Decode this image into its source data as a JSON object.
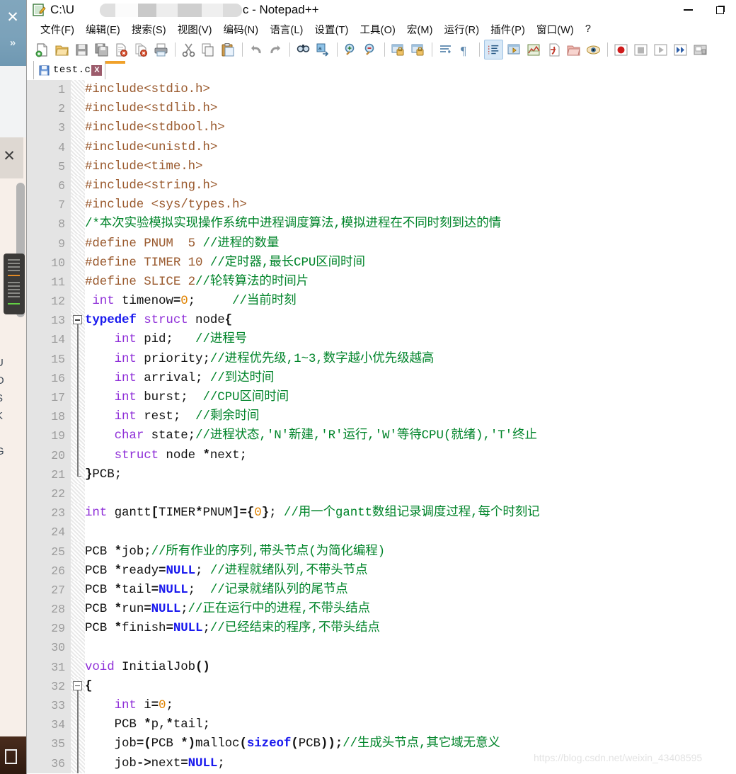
{
  "window": {
    "title_prefix": "C:\\U",
    "title_suffix": "\\test.c - Notepad++",
    "app_icon": "notepad-plus-plus-icon",
    "controls": {
      "minimize": "Minimize",
      "maximize": "Restore",
      "close": "Close"
    }
  },
  "menu": {
    "items": [
      {
        "label": "文件(F)",
        "name": "menu-file"
      },
      {
        "label": "编辑(E)",
        "name": "menu-edit"
      },
      {
        "label": "搜索(S)",
        "name": "menu-search"
      },
      {
        "label": "视图(V)",
        "name": "menu-view"
      },
      {
        "label": "编码(N)",
        "name": "menu-encoding"
      },
      {
        "label": "语言(L)",
        "name": "menu-language"
      },
      {
        "label": "设置(T)",
        "name": "menu-settings"
      },
      {
        "label": "工具(O)",
        "name": "menu-tools"
      },
      {
        "label": "宏(M)",
        "name": "menu-macro"
      },
      {
        "label": "运行(R)",
        "name": "menu-run"
      },
      {
        "label": "插件(P)",
        "name": "menu-plugins"
      },
      {
        "label": "窗口(W)",
        "name": "menu-window"
      },
      {
        "label": "?",
        "name": "menu-help"
      }
    ]
  },
  "toolbar": {
    "buttons": [
      {
        "icon": "new-file-icon",
        "group": 1
      },
      {
        "icon": "open-file-icon",
        "group": 1
      },
      {
        "icon": "save-icon",
        "group": 1
      },
      {
        "icon": "save-all-icon",
        "group": 1
      },
      {
        "icon": "close-file-icon",
        "group": 1
      },
      {
        "icon": "close-all-icon",
        "group": 1
      },
      {
        "icon": "print-icon",
        "group": 1
      },
      {
        "icon": "cut-icon",
        "group": 2
      },
      {
        "icon": "copy-icon",
        "group": 2
      },
      {
        "icon": "paste-icon",
        "group": 2
      },
      {
        "icon": "undo-icon",
        "group": 3
      },
      {
        "icon": "redo-icon",
        "group": 3
      },
      {
        "icon": "find-icon",
        "group": 4
      },
      {
        "icon": "replace-icon",
        "group": 4
      },
      {
        "icon": "zoom-in-icon",
        "group": 5
      },
      {
        "icon": "zoom-out-icon",
        "group": 5
      },
      {
        "icon": "sync-vertical-scroll-icon",
        "group": 6
      },
      {
        "icon": "sync-horizontal-scroll-icon",
        "group": 6
      },
      {
        "icon": "word-wrap-icon",
        "group": 7
      },
      {
        "icon": "show-all-characters-icon",
        "group": 7
      },
      {
        "icon": "indent-guide-icon",
        "group": 8,
        "active": true
      },
      {
        "icon": "user-defined-language-icon",
        "group": 8
      },
      {
        "icon": "document-map-icon",
        "group": 8
      },
      {
        "icon": "function-list-icon",
        "group": 8
      },
      {
        "icon": "folder-as-workspace-icon",
        "group": 8
      },
      {
        "icon": "monitoring-icon",
        "group": 8
      },
      {
        "icon": "macro-record-icon",
        "group": 9
      },
      {
        "icon": "macro-stop-icon",
        "group": 9
      },
      {
        "icon": "macro-play-icon",
        "group": 9
      },
      {
        "icon": "macro-run-multiple-icon",
        "group": 9
      },
      {
        "icon": "macro-save-icon",
        "group": 9
      }
    ]
  },
  "tab": {
    "label": "test.c",
    "icon": "saved-file-icon",
    "close_label": "X"
  },
  "watermark": "https://blog.csdn.net/weixin_43408595",
  "colors": {
    "preprocessor": "#9a5a2e",
    "comment": "#00842a",
    "keyword": "#8f2fd8",
    "instruction_word": "#1a1aee",
    "number": "#e08300",
    "plain": "#131313",
    "gutter_bg": "#e4e4e4",
    "gutter_text": "#9b9b9b",
    "tab_accent": "#f0a12a"
  },
  "editor": {
    "first_line": 1,
    "last_line": 36,
    "lines": [
      {
        "n": 1,
        "tokens": [
          {
            "t": "pre",
            "s": "#include<stdio.h>"
          }
        ]
      },
      {
        "n": 2,
        "tokens": [
          {
            "t": "pre",
            "s": "#include<stdlib.h>"
          }
        ]
      },
      {
        "n": 3,
        "tokens": [
          {
            "t": "pre",
            "s": "#include<stdbool.h>"
          }
        ]
      },
      {
        "n": 4,
        "tokens": [
          {
            "t": "pre",
            "s": "#include<unistd.h>"
          }
        ]
      },
      {
        "n": 5,
        "tokens": [
          {
            "t": "pre",
            "s": "#include<time.h>"
          }
        ]
      },
      {
        "n": 6,
        "tokens": [
          {
            "t": "pre",
            "s": "#include<string.h>"
          }
        ]
      },
      {
        "n": 7,
        "tokens": [
          {
            "t": "pre",
            "s": "#include <sys/types.h>"
          }
        ]
      },
      {
        "n": 8,
        "tokens": [
          {
            "t": "cmt",
            "s": "/*本次实验模拟实现操作系统中进程调度算法,模拟进程在不同时刻到达的情"
          }
        ]
      },
      {
        "n": 9,
        "tokens": [
          {
            "t": "pre",
            "s": "#define PNUM  5 "
          },
          {
            "t": "cmt",
            "s": "//进程的数量"
          }
        ]
      },
      {
        "n": 10,
        "tokens": [
          {
            "t": "pre",
            "s": "#define TIMER 10 "
          },
          {
            "t": "cmt",
            "s": "//定时器,最长CPU区间时间"
          }
        ]
      },
      {
        "n": 11,
        "tokens": [
          {
            "t": "pre",
            "s": "#define SLICE 2"
          },
          {
            "t": "cmt",
            "s": "//轮转算法的时间片"
          }
        ]
      },
      {
        "n": 12,
        "tokens": [
          {
            "t": "plain",
            "s": " "
          },
          {
            "t": "kw",
            "s": "int"
          },
          {
            "t": "plain",
            "s": " timenow"
          },
          {
            "t": "op",
            "s": "="
          },
          {
            "t": "num",
            "s": "0"
          },
          {
            "t": "plain",
            "s": ";     "
          },
          {
            "t": "cmt",
            "s": "//当前时刻"
          }
        ]
      },
      {
        "n": 13,
        "fold": "start",
        "tokens": [
          {
            "t": "kw2",
            "s": "typedef"
          },
          {
            "t": "plain",
            "s": " "
          },
          {
            "t": "kw",
            "s": "struct"
          },
          {
            "t": "plain",
            "s": " node"
          },
          {
            "t": "op",
            "s": "{"
          }
        ]
      },
      {
        "n": 14,
        "fold": "mid",
        "tokens": [
          {
            "t": "plain",
            "s": "    "
          },
          {
            "t": "kw",
            "s": "int"
          },
          {
            "t": "plain",
            "s": " pid;   "
          },
          {
            "t": "cmt",
            "s": "//进程号"
          }
        ]
      },
      {
        "n": 15,
        "fold": "mid",
        "tokens": [
          {
            "t": "plain",
            "s": "    "
          },
          {
            "t": "kw",
            "s": "int"
          },
          {
            "t": "plain",
            "s": " priority;"
          },
          {
            "t": "cmt",
            "s": "//进程优先级,1~3,数字越小优先级越高"
          }
        ]
      },
      {
        "n": 16,
        "fold": "mid",
        "tokens": [
          {
            "t": "plain",
            "s": "    "
          },
          {
            "t": "kw",
            "s": "int"
          },
          {
            "t": "plain",
            "s": " arrival; "
          },
          {
            "t": "cmt",
            "s": "//到达时间"
          }
        ]
      },
      {
        "n": 17,
        "fold": "mid",
        "tokens": [
          {
            "t": "plain",
            "s": "    "
          },
          {
            "t": "kw",
            "s": "int"
          },
          {
            "t": "plain",
            "s": " burst;  "
          },
          {
            "t": "cmt",
            "s": "//CPU区间时间"
          }
        ]
      },
      {
        "n": 18,
        "fold": "mid",
        "tokens": [
          {
            "t": "plain",
            "s": "    "
          },
          {
            "t": "kw",
            "s": "int"
          },
          {
            "t": "plain",
            "s": " rest;  "
          },
          {
            "t": "cmt",
            "s": "//剩余时间"
          }
        ]
      },
      {
        "n": 19,
        "fold": "mid",
        "tokens": [
          {
            "t": "plain",
            "s": "    "
          },
          {
            "t": "kw",
            "s": "char"
          },
          {
            "t": "plain",
            "s": " state;"
          },
          {
            "t": "cmt",
            "s": "//进程状态,'N'新建,'R'运行,'W'等待CPU(就绪),'T'终止"
          }
        ]
      },
      {
        "n": 20,
        "fold": "mid",
        "tokens": [
          {
            "t": "plain",
            "s": "    "
          },
          {
            "t": "kw",
            "s": "struct"
          },
          {
            "t": "plain",
            "s": " node "
          },
          {
            "t": "op",
            "s": "*"
          },
          {
            "t": "plain",
            "s": "next;"
          }
        ]
      },
      {
        "n": 21,
        "fold": "end",
        "tokens": [
          {
            "t": "op",
            "s": "}"
          },
          {
            "t": "plain",
            "s": "PCB;"
          }
        ]
      },
      {
        "n": 22,
        "tokens": []
      },
      {
        "n": 23,
        "tokens": [
          {
            "t": "kw",
            "s": "int"
          },
          {
            "t": "plain",
            "s": " gantt"
          },
          {
            "t": "op",
            "s": "["
          },
          {
            "t": "plain",
            "s": "TIMER"
          },
          {
            "t": "op",
            "s": "*"
          },
          {
            "t": "plain",
            "s": "PNUM"
          },
          {
            "t": "op",
            "s": "]={"
          },
          {
            "t": "num",
            "s": "0"
          },
          {
            "t": "op",
            "s": "}"
          },
          {
            "t": "plain",
            "s": "; "
          },
          {
            "t": "cmt",
            "s": "//用一个gantt数组记录调度过程,每个时刻记"
          }
        ]
      },
      {
        "n": 24,
        "tokens": []
      },
      {
        "n": 25,
        "tokens": [
          {
            "t": "plain",
            "s": "PCB "
          },
          {
            "t": "op",
            "s": "*"
          },
          {
            "t": "plain",
            "s": "job;"
          },
          {
            "t": "cmt",
            "s": "//所有作业的序列,带头节点(为简化编程)"
          }
        ]
      },
      {
        "n": 26,
        "tokens": [
          {
            "t": "plain",
            "s": "PCB "
          },
          {
            "t": "op",
            "s": "*"
          },
          {
            "t": "plain",
            "s": "ready"
          },
          {
            "t": "op",
            "s": "="
          },
          {
            "t": "kw2",
            "s": "NULL"
          },
          {
            "t": "plain",
            "s": "; "
          },
          {
            "t": "cmt",
            "s": "//进程就绪队列,不带头节点"
          }
        ]
      },
      {
        "n": 27,
        "tokens": [
          {
            "t": "plain",
            "s": "PCB "
          },
          {
            "t": "op",
            "s": "*"
          },
          {
            "t": "plain",
            "s": "tail"
          },
          {
            "t": "op",
            "s": "="
          },
          {
            "t": "kw2",
            "s": "NULL"
          },
          {
            "t": "plain",
            "s": ";  "
          },
          {
            "t": "cmt",
            "s": "//记录就绪队列的尾节点"
          }
        ]
      },
      {
        "n": 28,
        "tokens": [
          {
            "t": "plain",
            "s": "PCB "
          },
          {
            "t": "op",
            "s": "*"
          },
          {
            "t": "plain",
            "s": "run"
          },
          {
            "t": "op",
            "s": "="
          },
          {
            "t": "kw2",
            "s": "NULL"
          },
          {
            "t": "plain",
            "s": ";"
          },
          {
            "t": "cmt",
            "s": "//正在运行中的进程,不带头结点"
          }
        ]
      },
      {
        "n": 29,
        "tokens": [
          {
            "t": "plain",
            "s": "PCB "
          },
          {
            "t": "op",
            "s": "*"
          },
          {
            "t": "plain",
            "s": "finish"
          },
          {
            "t": "op",
            "s": "="
          },
          {
            "t": "kw2",
            "s": "NULL"
          },
          {
            "t": "plain",
            "s": ";"
          },
          {
            "t": "cmt",
            "s": "//已经结束的程序,不带头结点"
          }
        ]
      },
      {
        "n": 30,
        "tokens": []
      },
      {
        "n": 31,
        "tokens": [
          {
            "t": "kw",
            "s": "void"
          },
          {
            "t": "plain",
            "s": " InitialJob"
          },
          {
            "t": "op",
            "s": "()"
          }
        ]
      },
      {
        "n": 32,
        "fold": "start2",
        "tokens": [
          {
            "t": "op",
            "s": "{"
          }
        ]
      },
      {
        "n": 33,
        "fold": "mid",
        "tokens": [
          {
            "t": "plain",
            "s": "    "
          },
          {
            "t": "kw",
            "s": "int"
          },
          {
            "t": "plain",
            "s": " i"
          },
          {
            "t": "op",
            "s": "="
          },
          {
            "t": "num",
            "s": "0"
          },
          {
            "t": "plain",
            "s": ";"
          }
        ]
      },
      {
        "n": 34,
        "fold": "mid",
        "tokens": [
          {
            "t": "plain",
            "s": "    PCB "
          },
          {
            "t": "op",
            "s": "*"
          },
          {
            "t": "plain",
            "s": "p,"
          },
          {
            "t": "op",
            "s": "*"
          },
          {
            "t": "plain",
            "s": "tail;"
          }
        ]
      },
      {
        "n": 35,
        "fold": "mid",
        "tokens": [
          {
            "t": "plain",
            "s": "    job"
          },
          {
            "t": "op",
            "s": "=("
          },
          {
            "t": "plain",
            "s": "PCB "
          },
          {
            "t": "op",
            "s": "*)"
          },
          {
            "t": "plain",
            "s": "malloc"
          },
          {
            "t": "op",
            "s": "("
          },
          {
            "t": "kw2",
            "s": "sizeof"
          },
          {
            "t": "op",
            "s": "("
          },
          {
            "t": "plain",
            "s": "PCB"
          },
          {
            "t": "op",
            "s": "));"
          },
          {
            "t": "cmt",
            "s": "//生成头节点,其它域无意义"
          }
        ]
      },
      {
        "n": 36,
        "fold": "mid",
        "tokens": [
          {
            "t": "plain",
            "s": "    job"
          },
          {
            "t": "op",
            "s": "->"
          },
          {
            "t": "plain",
            "s": "next"
          },
          {
            "t": "op",
            "s": "="
          },
          {
            "t": "kw2",
            "s": "NULL"
          },
          {
            "t": "plain",
            "s": ";"
          }
        ]
      }
    ]
  },
  "background": {
    "left_panel_close": "✕",
    "left_panel_expand": "»",
    "grey_close": "✕",
    "side_letters": [
      "U",
      "O",
      "S",
      "K",
      "-",
      "G"
    ]
  }
}
